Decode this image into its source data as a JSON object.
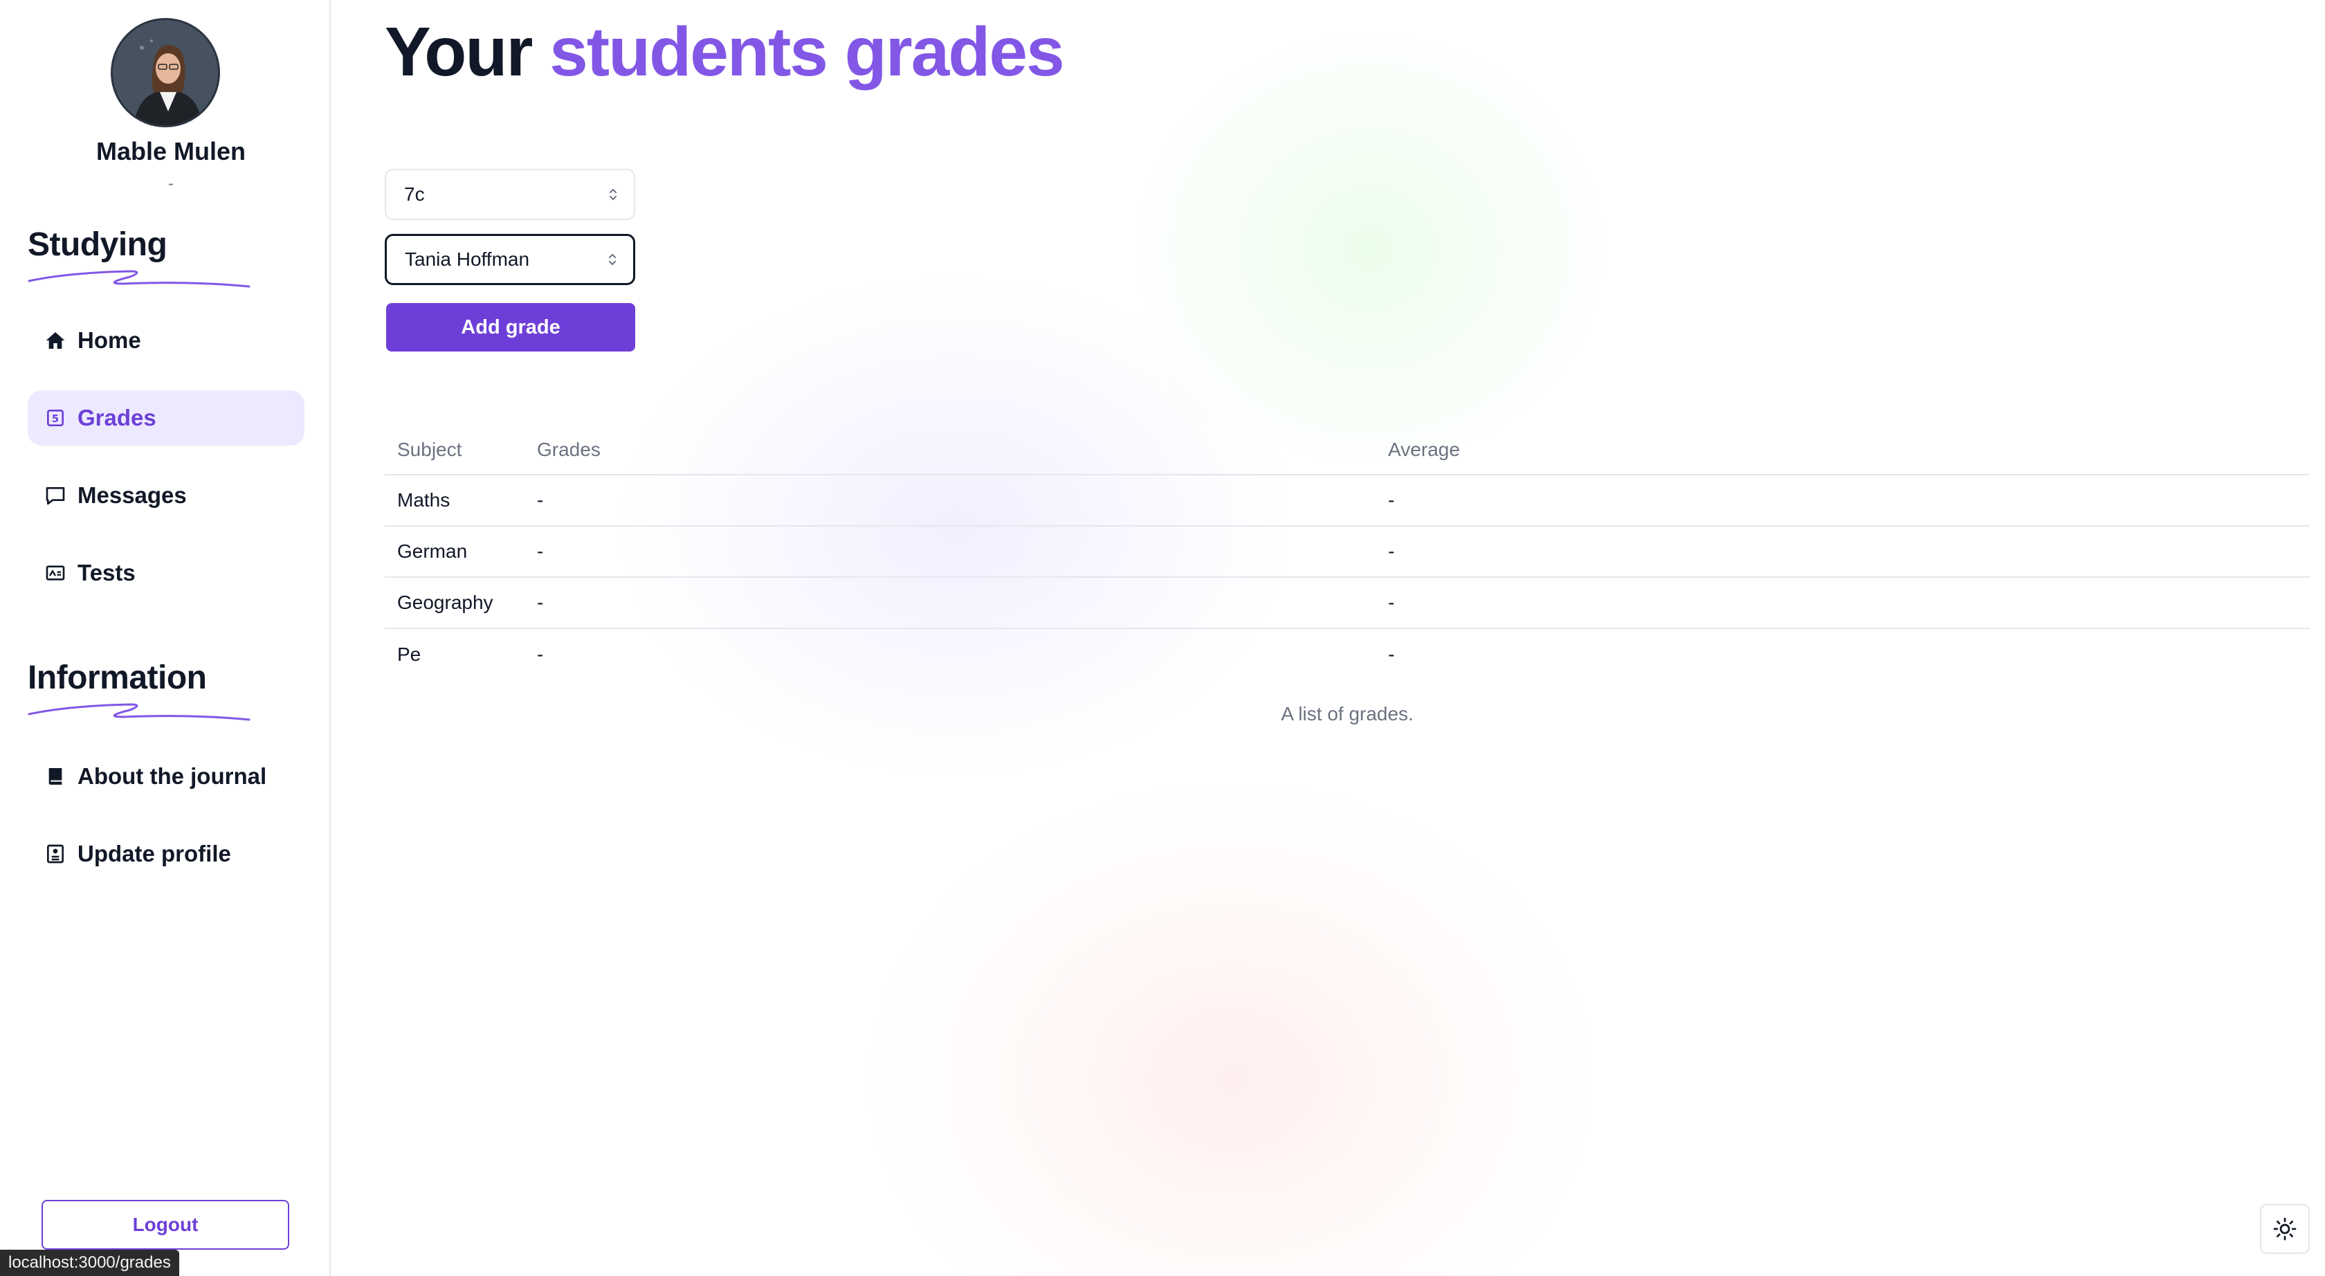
{
  "user": {
    "name": "Mable Mulen",
    "subtitle": "-"
  },
  "sidebar": {
    "studying_title": "Studying",
    "studying_items": [
      {
        "label": "Home",
        "icon": "home-icon",
        "active": false
      },
      {
        "label": "Grades",
        "icon": "grades-icon",
        "active": true
      },
      {
        "label": "Messages",
        "icon": "message-icon",
        "active": false
      },
      {
        "label": "Tests",
        "icon": "tests-icon",
        "active": false
      }
    ],
    "information_title": "Information",
    "information_items": [
      {
        "label": "About the journal",
        "icon": "book-icon"
      },
      {
        "label": "Update profile",
        "icon": "profile-icon"
      }
    ],
    "logout_label": "Logout"
  },
  "status_url": "localhost:3000/grades",
  "main": {
    "title_prefix": "Your",
    "title_accent": "students grades",
    "class_select": {
      "value": "7c"
    },
    "student_select": {
      "value": "Tania Hoffman"
    },
    "add_grade_label": "Add grade",
    "table": {
      "headers": [
        "Subject",
        "Grades",
        "Average"
      ],
      "rows": [
        {
          "subject": "Maths",
          "grades": "-",
          "average": "-"
        },
        {
          "subject": "German",
          "grades": "-",
          "average": "-"
        },
        {
          "subject": "Geography",
          "grades": "-",
          "average": "-"
        },
        {
          "subject": "Pe",
          "grades": "-",
          "average": "-"
        }
      ],
      "caption": "A list of grades."
    }
  },
  "colors": {
    "accent": "#6d3fd8",
    "accent_light": "#8257e6",
    "active_bg": "#ede9fe"
  }
}
